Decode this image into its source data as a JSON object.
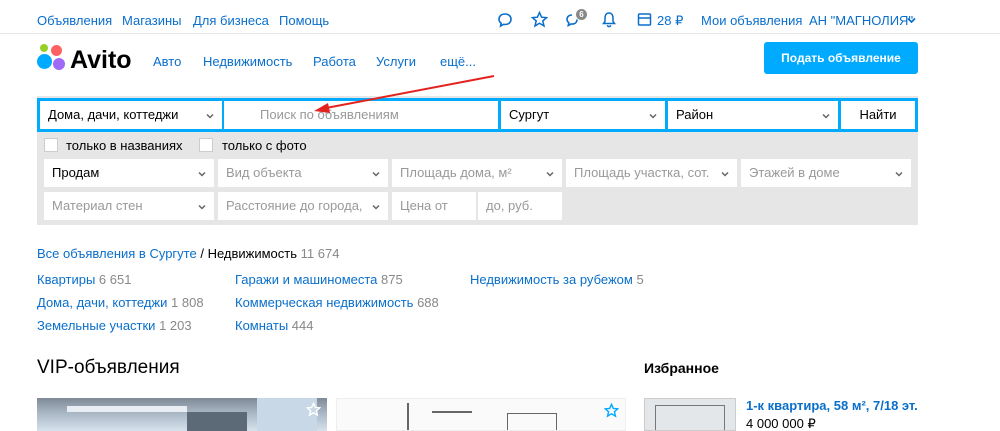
{
  "topnav": {
    "links": [
      "Объявления",
      "Магазины",
      "Для бизнеса",
      "Помощь"
    ],
    "notifications_badge": "6",
    "wallet": "28 ₽",
    "my_ads": "Мои объявления",
    "account": "АН \"МАГНОЛИЯ\""
  },
  "logo": {
    "text": "Avito"
  },
  "mainnav": [
    "Авто",
    "Недвижимость",
    "Работа",
    "Услуги",
    "ещё..."
  ],
  "post_button": "Подать объявление",
  "search": {
    "category": "Дома, дачи, коттеджи",
    "query_placeholder": "Поиск по объявлениям",
    "city": "Сургут",
    "district_placeholder": "Район",
    "find_button": "Найти",
    "only_titles": "только в названиях",
    "only_photo": "только с фото"
  },
  "filters": {
    "row1": [
      "Продам",
      "Вид объекта",
      "Площадь дома, м²",
      "Площадь участка, сот.",
      "Этажей в доме"
    ],
    "row2": [
      "Материал стен",
      "Расстояние до города,",
      "Цена от",
      "до, руб."
    ]
  },
  "breadcrumb": {
    "link": "Все объявления в Сургуте",
    "sep": " / ",
    "current": "Недвижимость",
    "count": "11 674"
  },
  "categories": {
    "col1": [
      {
        "label": "Квартиры",
        "count": "6 651"
      },
      {
        "label": "Дома, дачи, коттеджи",
        "count": "1 808"
      },
      {
        "label": "Земельные участки",
        "count": "1 203"
      }
    ],
    "col2": [
      {
        "label": "Гаражи и машиноместа",
        "count": "875"
      },
      {
        "label": "Коммерческая недвижимость",
        "count": "688"
      },
      {
        "label": "Комнаты",
        "count": "444"
      }
    ],
    "col3": [
      {
        "label": "Недвижимость за рубежом",
        "count": "5"
      }
    ]
  },
  "vip_title": "VIP-объявления",
  "favorites": {
    "title": "Избранное",
    "item_title": "1-к квартира, 58 м², 7/18 эт.",
    "item_price": "4 000 000 ₽"
  },
  "colors": {
    "link": "#0a6fcb",
    "accent": "#00aaff",
    "panel": "#e6e6e6",
    "arrow": "#e3231f"
  }
}
